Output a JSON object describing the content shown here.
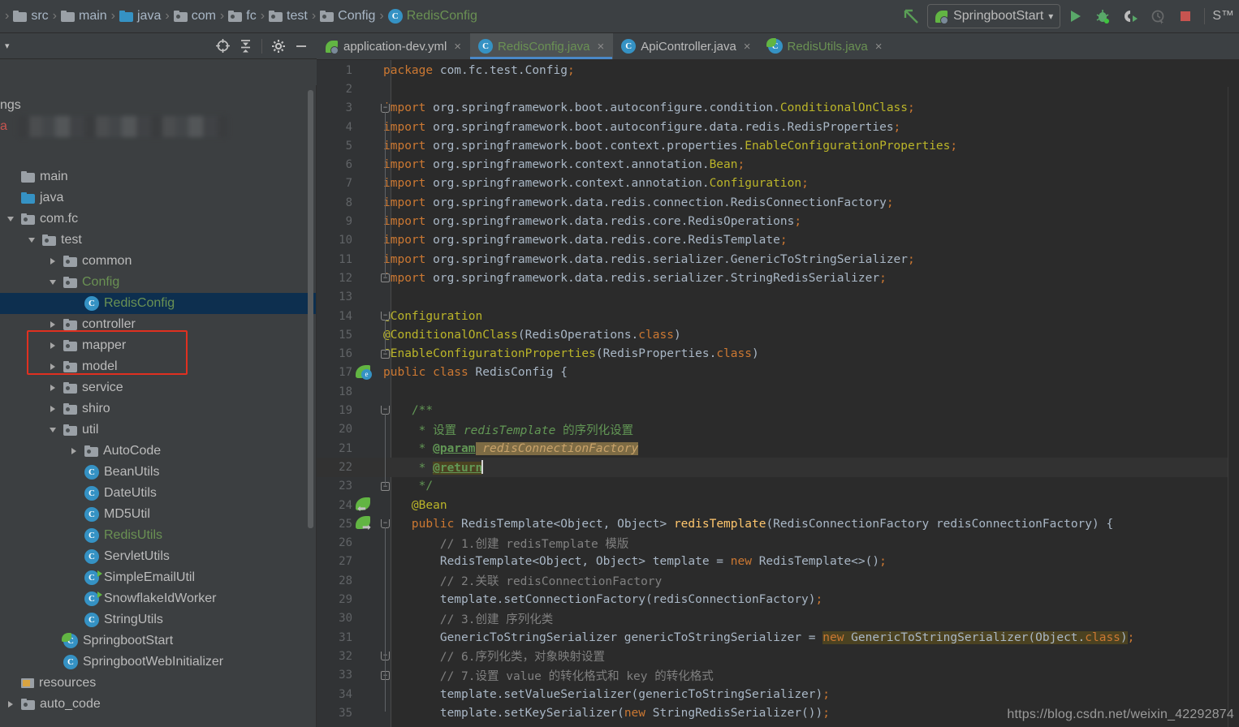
{
  "breadcrumb": {
    "separator": "›",
    "items": [
      {
        "label": "src",
        "icon": "folder-icon",
        "kind": "folder-src"
      },
      {
        "label": "main",
        "icon": "folder-icon",
        "kind": "folder-src"
      },
      {
        "label": "java",
        "icon": "folder-source-icon",
        "kind": "folder-blue"
      },
      {
        "label": "com",
        "icon": "package-icon",
        "kind": "package"
      },
      {
        "label": "fc",
        "icon": "package-icon",
        "kind": "package"
      },
      {
        "label": "test",
        "icon": "package-icon",
        "kind": "package"
      },
      {
        "label": "Config",
        "icon": "package-icon",
        "kind": "package"
      },
      {
        "label": "RedisConfig",
        "icon": "java-class-icon",
        "kind": "class"
      }
    ]
  },
  "toolbar": {
    "back_arrow_icon": "arrow-up-left-icon",
    "run_config": {
      "name": "SpringbootStart",
      "icon": "spring-boot-icon",
      "chevron": "▾"
    },
    "buttons": [
      {
        "name": "run-button",
        "icon": "play-icon",
        "enabled": true
      },
      {
        "name": "debug-button",
        "icon": "bug-icon",
        "enabled": true
      },
      {
        "name": "coverage-button",
        "icon": "run-coverage-icon",
        "enabled": true
      },
      {
        "name": "profile-button",
        "icon": "profiler-icon",
        "enabled": false
      },
      {
        "name": "stop-button",
        "icon": "stop-square-icon",
        "enabled": true
      }
    ],
    "tail_label": "S™"
  },
  "project_panel": {
    "header": {
      "collapse_caret": "▾",
      "icons": [
        {
          "name": "locate-target-icon"
        },
        {
          "name": "collapse-all-icon"
        },
        {
          "name": "settings-gear-icon"
        },
        {
          "name": "hide-panel-icon"
        }
      ]
    },
    "censored_row_hint": "blurred-project-name",
    "partial_top_rows": [
      {
        "label": "ngs",
        "color": "normal"
      },
      {
        "label": "a",
        "color": "red"
      }
    ],
    "tree": [
      {
        "label": "main",
        "indent": 0,
        "twisty": "none",
        "icon": "folder-icon",
        "color": "normal",
        "selected": false
      },
      {
        "label": "java",
        "indent": 0,
        "twisty": "none",
        "icon": "folder-source-icon",
        "color": "normal",
        "selected": false
      },
      {
        "label": "com.fc",
        "indent": 0,
        "twisty": "open",
        "icon": "package-icon",
        "color": "normal",
        "selected": false
      },
      {
        "label": "test",
        "indent": 1,
        "twisty": "open",
        "icon": "package-icon",
        "color": "normal",
        "selected": false
      },
      {
        "label": "common",
        "indent": 2,
        "twisty": "closed",
        "icon": "package-icon",
        "color": "normal",
        "selected": false
      },
      {
        "label": "Config",
        "indent": 2,
        "twisty": "open",
        "icon": "package-icon",
        "color": "green",
        "selected": false
      },
      {
        "label": "RedisConfig",
        "indent": 3,
        "twisty": "none",
        "icon": "java-class-icon",
        "color": "green",
        "selected": true
      },
      {
        "label": "controller",
        "indent": 2,
        "twisty": "closed",
        "icon": "package-icon",
        "color": "normal",
        "selected": false
      },
      {
        "label": "mapper",
        "indent": 2,
        "twisty": "closed",
        "icon": "package-icon",
        "color": "normal",
        "selected": false
      },
      {
        "label": "model",
        "indent": 2,
        "twisty": "closed",
        "icon": "package-icon",
        "color": "normal",
        "selected": false
      },
      {
        "label": "service",
        "indent": 2,
        "twisty": "closed",
        "icon": "package-icon",
        "color": "normal",
        "selected": false
      },
      {
        "label": "shiro",
        "indent": 2,
        "twisty": "closed",
        "icon": "package-icon",
        "color": "normal",
        "selected": false
      },
      {
        "label": "util",
        "indent": 2,
        "twisty": "open",
        "icon": "package-icon",
        "color": "normal",
        "selected": false
      },
      {
        "label": "AutoCode",
        "indent": 3,
        "twisty": "closed",
        "icon": "package-icon",
        "color": "normal",
        "selected": false
      },
      {
        "label": "BeanUtils",
        "indent": 3,
        "twisty": "none",
        "icon": "java-class-icon",
        "color": "normal",
        "selected": false
      },
      {
        "label": "DateUtils",
        "indent": 3,
        "twisty": "none",
        "icon": "java-class-icon",
        "color": "normal",
        "selected": false
      },
      {
        "label": "MD5Util",
        "indent": 3,
        "twisty": "none",
        "icon": "java-class-icon",
        "color": "normal",
        "selected": false
      },
      {
        "label": "RedisUtils",
        "indent": 3,
        "twisty": "none",
        "icon": "java-class-icon",
        "color": "green",
        "selected": false
      },
      {
        "label": "ServletUtils",
        "indent": 3,
        "twisty": "none",
        "icon": "java-class-icon",
        "color": "normal",
        "selected": false
      },
      {
        "label": "SimpleEmailUtil",
        "indent": 3,
        "twisty": "none",
        "icon": "java-class-runnable-icon",
        "color": "normal",
        "selected": false
      },
      {
        "label": "SnowflakeIdWorker",
        "indent": 3,
        "twisty": "none",
        "icon": "java-class-runnable-icon",
        "color": "normal",
        "selected": false
      },
      {
        "label": "StringUtils",
        "indent": 3,
        "twisty": "none",
        "icon": "java-class-icon",
        "color": "normal",
        "selected": false
      },
      {
        "label": "SpringbootStart",
        "indent": 2,
        "twisty": "none",
        "icon": "spring-boot-class-icon",
        "color": "normal",
        "selected": false
      },
      {
        "label": "SpringbootWebInitializer",
        "indent": 2,
        "twisty": "none",
        "icon": "java-class-icon",
        "color": "normal",
        "selected": false
      },
      {
        "label": "resources",
        "indent": 0,
        "twisty": "none",
        "icon": "resources-folder-icon",
        "color": "normal",
        "selected": false
      },
      {
        "label": "auto_code",
        "indent": 0,
        "twisty": "closed",
        "icon": "package-icon",
        "color": "normal",
        "selected": false
      }
    ]
  },
  "editor": {
    "tabs": [
      {
        "label": "application-dev.yml",
        "icon": "spring-yaml-icon",
        "color": "plain",
        "active": false,
        "close": "×"
      },
      {
        "label": "RedisConfig.java",
        "icon": "java-class-icon",
        "color": "green",
        "active": true,
        "close": "×"
      },
      {
        "label": "ApiController.java",
        "icon": "java-class-icon",
        "color": "plain",
        "active": false,
        "close": "×"
      },
      {
        "label": "RedisUtils.java",
        "icon": "java-class-icon",
        "color": "green",
        "active": false,
        "close": "×"
      }
    ],
    "caret_line": 22,
    "lines": [
      {
        "n": 1,
        "tokens": [
          {
            "t": "package ",
            "c": "kw"
          },
          {
            "t": "com.fc.test.Config",
            "c": "cls"
          },
          {
            "t": ";",
            "c": "sem"
          }
        ]
      },
      {
        "n": 2,
        "tokens": []
      },
      {
        "n": 3,
        "tokens": [
          {
            "t": "import ",
            "c": "kw"
          },
          {
            "t": "org.springframework.boot.autoconfigure.condition.",
            "c": "cls"
          },
          {
            "t": "ConditionalOnClass",
            "c": "an"
          },
          {
            "t": ";",
            "c": "sem"
          }
        ]
      },
      {
        "n": 4,
        "tokens": [
          {
            "t": "import ",
            "c": "kw"
          },
          {
            "t": "org.springframework.boot.autoconfigure.data.redis.RedisProperties",
            "c": "cls"
          },
          {
            "t": ";",
            "c": "sem"
          }
        ]
      },
      {
        "n": 5,
        "tokens": [
          {
            "t": "import ",
            "c": "kw"
          },
          {
            "t": "org.springframework.boot.context.properties.",
            "c": "cls"
          },
          {
            "t": "EnableConfigurationProperties",
            "c": "an"
          },
          {
            "t": ";",
            "c": "sem"
          }
        ]
      },
      {
        "n": 6,
        "tokens": [
          {
            "t": "import ",
            "c": "kw"
          },
          {
            "t": "org.springframework.context.annotation.",
            "c": "cls"
          },
          {
            "t": "Bean",
            "c": "an"
          },
          {
            "t": ";",
            "c": "sem"
          }
        ]
      },
      {
        "n": 7,
        "tokens": [
          {
            "t": "import ",
            "c": "kw"
          },
          {
            "t": "org.springframework.context.annotation.",
            "c": "cls"
          },
          {
            "t": "Configuration",
            "c": "an"
          },
          {
            "t": ";",
            "c": "sem"
          }
        ]
      },
      {
        "n": 8,
        "tokens": [
          {
            "t": "import ",
            "c": "kw"
          },
          {
            "t": "org.springframework.data.redis.connection.RedisConnectionFactory",
            "c": "cls"
          },
          {
            "t": ";",
            "c": "sem"
          }
        ]
      },
      {
        "n": 9,
        "tokens": [
          {
            "t": "import ",
            "c": "kw"
          },
          {
            "t": "org.springframework.data.redis.core.RedisOperations",
            "c": "cls"
          },
          {
            "t": ";",
            "c": "sem"
          }
        ]
      },
      {
        "n": 10,
        "tokens": [
          {
            "t": "import ",
            "c": "kw"
          },
          {
            "t": "org.springframework.data.redis.core.RedisTemplate",
            "c": "cls"
          },
          {
            "t": ";",
            "c": "sem"
          }
        ]
      },
      {
        "n": 11,
        "tokens": [
          {
            "t": "import ",
            "c": "kw"
          },
          {
            "t": "org.springframework.data.redis.serializer.GenericToStringSerializer",
            "c": "cls"
          },
          {
            "t": ";",
            "c": "sem"
          }
        ]
      },
      {
        "n": 12,
        "tokens": [
          {
            "t": "import ",
            "c": "kw"
          },
          {
            "t": "org.springframework.data.redis.serializer.StringRedisSerializer",
            "c": "cls"
          },
          {
            "t": ";",
            "c": "sem"
          }
        ]
      },
      {
        "n": 13,
        "tokens": []
      },
      {
        "n": 14,
        "tokens": [
          {
            "t": "@Configuration",
            "c": "an"
          }
        ]
      },
      {
        "n": 15,
        "tokens": [
          {
            "t": "@ConditionalOnClass",
            "c": "an"
          },
          {
            "t": "(RedisOperations.",
            "c": "cls"
          },
          {
            "t": "class",
            "c": "kw"
          },
          {
            "t": ")",
            "c": "cls"
          }
        ]
      },
      {
        "n": 16,
        "tokens": [
          {
            "t": "@EnableConfigurationProperties",
            "c": "an"
          },
          {
            "t": "(RedisProperties.",
            "c": "cls"
          },
          {
            "t": "class",
            "c": "kw"
          },
          {
            "t": ")",
            "c": "cls"
          }
        ]
      },
      {
        "n": 17,
        "tokens": [
          {
            "t": "public class ",
            "c": "kw"
          },
          {
            "t": "RedisConfig {",
            "c": "cls"
          }
        ]
      },
      {
        "n": 18,
        "tokens": []
      },
      {
        "n": 19,
        "tokens": [
          {
            "t": "    /**",
            "c": "doc"
          }
        ]
      },
      {
        "n": 20,
        "tokens": [
          {
            "t": "     * 设置 ",
            "c": "doc"
          },
          {
            "t": "redisTemplate",
            "c": "doci"
          },
          {
            "t": " 的序列化设置",
            "c": "doc"
          }
        ]
      },
      {
        "n": 21,
        "tokens": [
          {
            "t": "     * ",
            "c": "doc"
          },
          {
            "t": "@param",
            "c": "doctag"
          },
          {
            "t": " redisConnectionFactory",
            "c": "hl-ident"
          }
        ]
      },
      {
        "n": 22,
        "tokens": [
          {
            "t": "     * ",
            "c": "doc"
          },
          {
            "t": "@return",
            "c": "doctag hl-srch"
          },
          {
            "t": "__CARET__",
            "c": "caret"
          }
        ]
      },
      {
        "n": 23,
        "tokens": [
          {
            "t": "     */",
            "c": "doc"
          }
        ]
      },
      {
        "n": 24,
        "tokens": [
          {
            "t": "    @Bean",
            "c": "an"
          }
        ]
      },
      {
        "n": 25,
        "tokens": [
          {
            "t": "    public ",
            "c": "kw"
          },
          {
            "t": "RedisTemplate<Object, Object> ",
            "c": "cls"
          },
          {
            "t": "redisTemplate",
            "c": "mth"
          },
          {
            "t": "(RedisConnectionFactory redisConnectionFactory) {",
            "c": "cls"
          }
        ]
      },
      {
        "n": 26,
        "tokens": [
          {
            "t": "        // 1.创建 redisTemplate 模版",
            "c": "cmt"
          }
        ]
      },
      {
        "n": 27,
        "tokens": [
          {
            "t": "        RedisTemplate<Object, Object> template = ",
            "c": "cls"
          },
          {
            "t": "new ",
            "c": "kw"
          },
          {
            "t": "RedisTemplate<>()",
            "c": "cls"
          },
          {
            "t": ";",
            "c": "sem"
          }
        ]
      },
      {
        "n": 28,
        "tokens": [
          {
            "t": "        // 2.关联 redisConnectionFactory",
            "c": "cmt"
          }
        ]
      },
      {
        "n": 29,
        "tokens": [
          {
            "t": "        template.setConnectionFactory(redisConnectionFactory)",
            "c": "cls"
          },
          {
            "t": ";",
            "c": "sem"
          }
        ]
      },
      {
        "n": 30,
        "tokens": [
          {
            "t": "        // 3.创建 序列化类",
            "c": "cmt"
          }
        ]
      },
      {
        "n": 31,
        "tokens": [
          {
            "t": "        GenericToStringSerializer genericToStringSerializer = ",
            "c": "cls"
          },
          {
            "t": "new ",
            "c": "kw hl-srch"
          },
          {
            "t": "GenericToStringSerializer(Object.",
            "c": "cls hl-srch"
          },
          {
            "t": "class",
            "c": "kw hl-srch"
          },
          {
            "t": ")",
            "c": "cls hl-srch"
          },
          {
            "t": ";",
            "c": "sem"
          }
        ]
      },
      {
        "n": 32,
        "tokens": [
          {
            "t": "        // 6.序列化类，对象映射设置",
            "c": "cmt"
          }
        ]
      },
      {
        "n": 33,
        "tokens": [
          {
            "t": "        // 7.设置 value 的转化格式和 key 的转化格式",
            "c": "cmt"
          }
        ]
      },
      {
        "n": 34,
        "tokens": [
          {
            "t": "        template.setValueSerializer(genericToStringSerializer)",
            "c": "cls"
          },
          {
            "t": ";",
            "c": "sem"
          }
        ]
      },
      {
        "n": 35,
        "tokens": [
          {
            "t": "        template.setKeySerializer(",
            "c": "cls"
          },
          {
            "t": "new ",
            "c": "kw"
          },
          {
            "t": "StringRedisSerializer())",
            "c": "cls"
          },
          {
            "t": ";",
            "c": "sem"
          }
        ]
      }
    ],
    "gutter_markers": [
      {
        "line": 17,
        "icon": "spring-bean-class-icon",
        "arrow": "none"
      },
      {
        "line": 24,
        "icon": "spring-bean-icon",
        "arrow": "left"
      },
      {
        "line": 25,
        "icon": "spring-bean-icon",
        "arrow": "right"
      }
    ],
    "fold_markers": [
      {
        "line": 3,
        "type": "collapse-down"
      },
      {
        "line": 12,
        "type": "collapse-end"
      },
      {
        "line": 14,
        "type": "collapse-down"
      },
      {
        "line": 16,
        "type": "collapse-end"
      },
      {
        "line": 19,
        "type": "collapse-down"
      },
      {
        "line": 23,
        "type": "collapse-end"
      },
      {
        "line": 25,
        "type": "collapse-down"
      },
      {
        "line": 32,
        "type": "collapse-down"
      },
      {
        "line": 33,
        "type": "collapse-end"
      }
    ]
  },
  "watermark": {
    "text": "https://blog.csdn.net/weixin_42292874"
  },
  "colors": {
    "window_bg": "#3c3f41",
    "toolbar_bg": "#3c4043",
    "editor_bg": "#2b2b2b",
    "gutter_bg": "#313335",
    "tab_active_bg": "#4e5254",
    "tab_underline": "#4a88c7",
    "tree_selection": "#0d2f4f",
    "annotation_rect": "#e03020",
    "keyword": "#cc7832",
    "annotation_token": "#bbb529",
    "method": "#ffc66d",
    "comment": "#808080",
    "javadoc": "#629755",
    "identifier": "#a9b7c6",
    "search_highlight": "#4b4221",
    "green_file": "#6a9153",
    "spring_green": "#62b543",
    "class_icon_blue": "#3592c4"
  }
}
